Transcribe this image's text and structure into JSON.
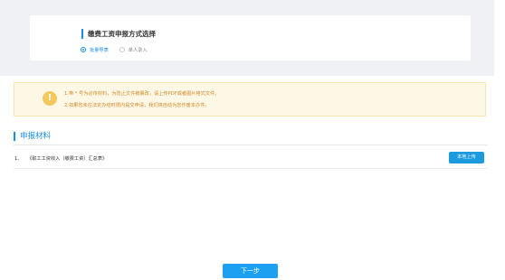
{
  "method_card": {
    "title": "缴费工资申报方式选择",
    "options": [
      {
        "label": "批量导表",
        "selected": true
      },
      {
        "label": "单人录入",
        "selected": false
      }
    ]
  },
  "notice": {
    "icon": "exclamation-icon",
    "lines": [
      "1.带 * 号为必传材料，为防止文件被篡改，请上传PDF或者图片格式文件。",
      "2.如果您未在法定办结时限内提交申请，我们将自动为您作废本办件。"
    ]
  },
  "materials": {
    "title": "申报材料",
    "items": [
      {
        "num": "1、",
        "name": "《职工工资收入（缴费工资）汇总表》",
        "upload_label": "本地上传"
      }
    ]
  },
  "footer": {
    "next_label": "下一步"
  },
  "colors": {
    "accent": "#1b8fe8",
    "notice_bg": "#fdf8e6",
    "notice_text": "#d0892a",
    "band_bg": "#f0f1f5"
  }
}
